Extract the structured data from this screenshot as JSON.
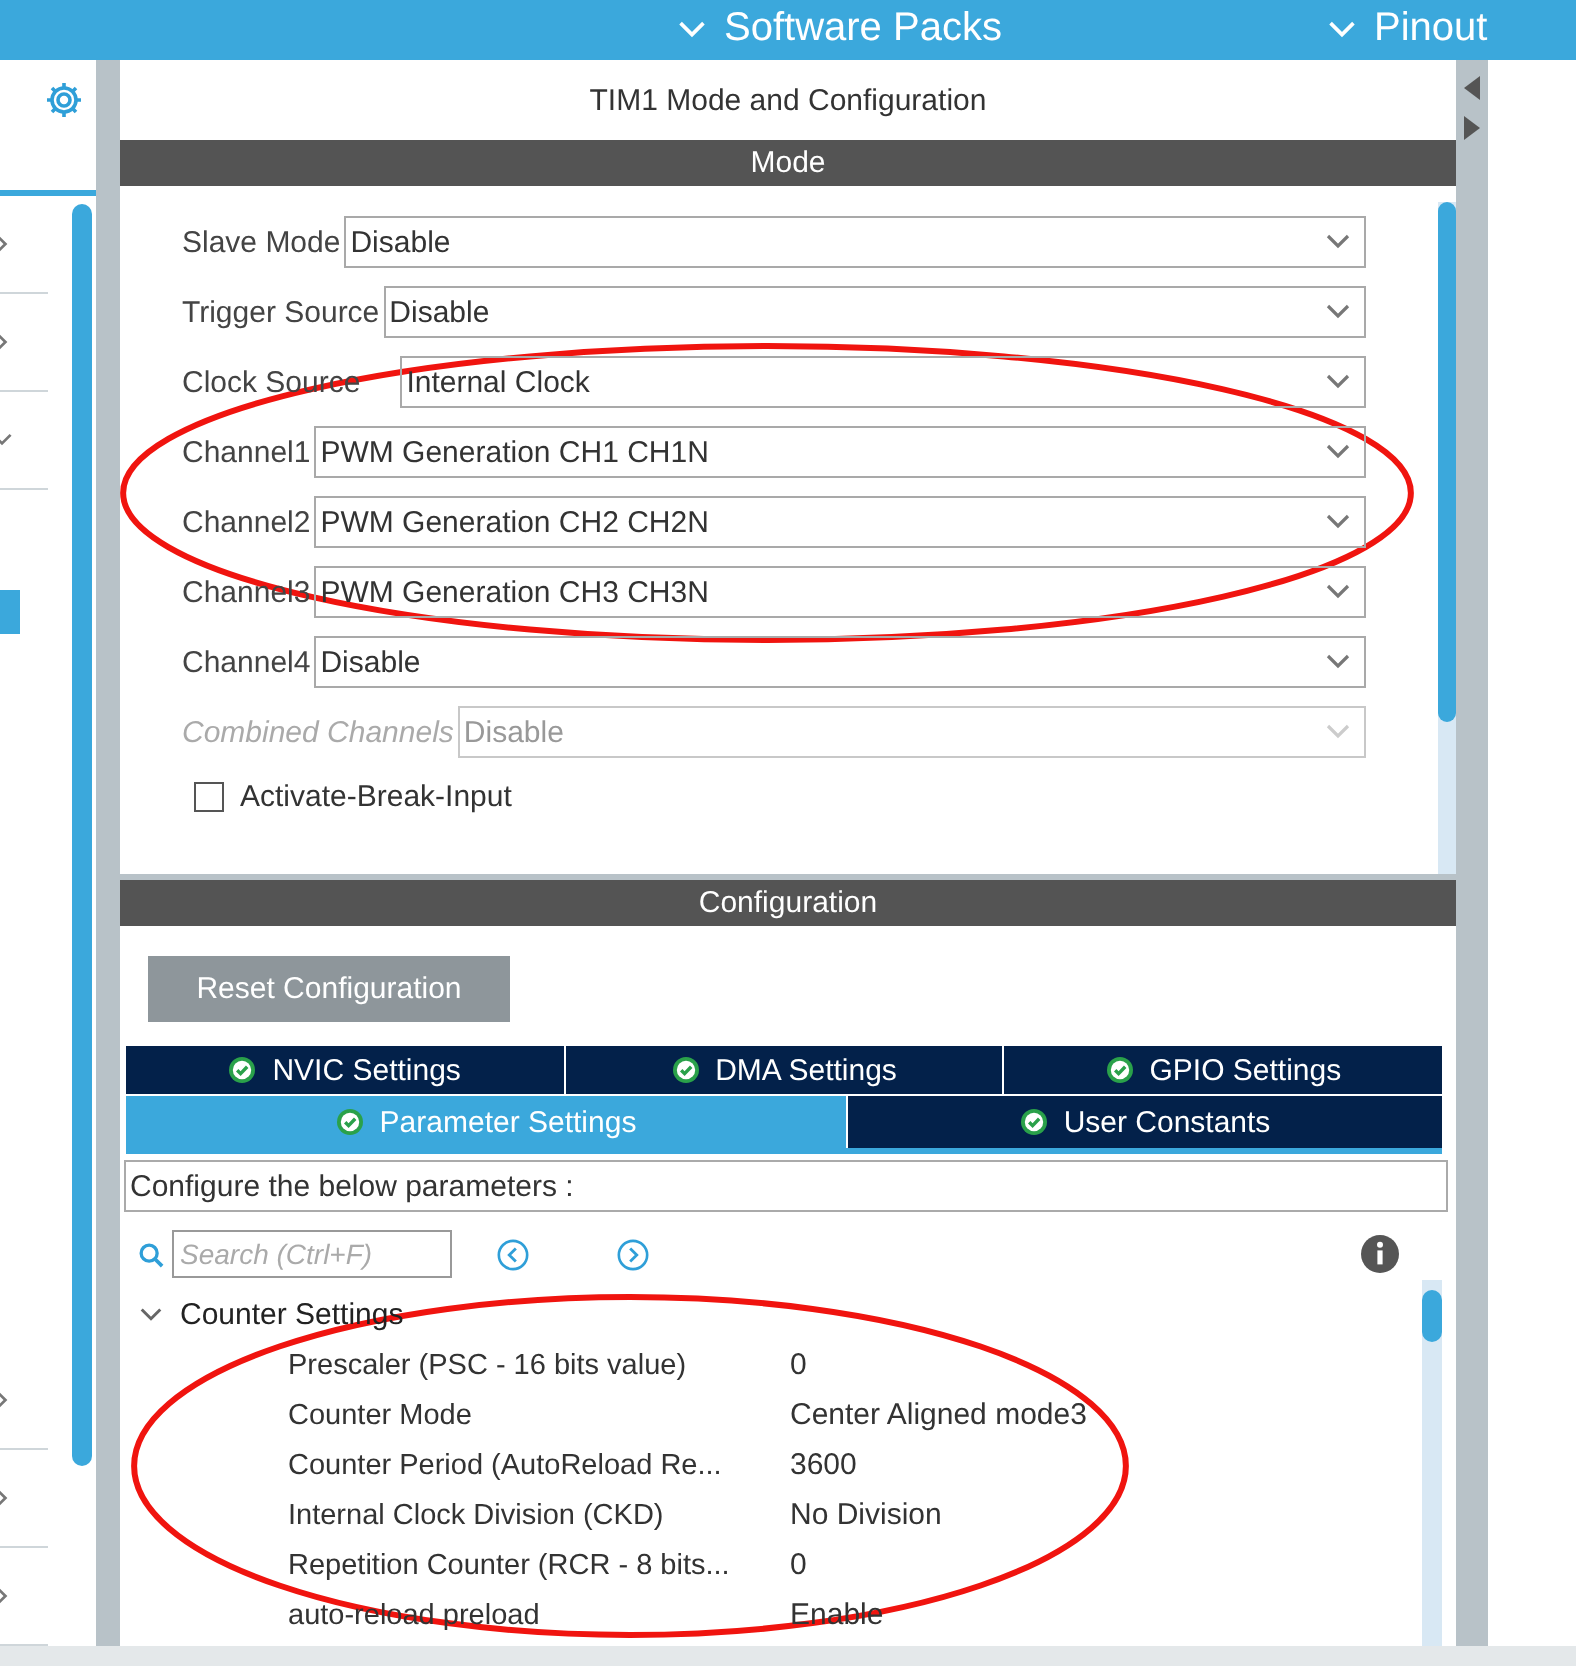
{
  "top_bar": {
    "menus": [
      {
        "label": "Software Packs"
      },
      {
        "label": "Pinout"
      }
    ]
  },
  "sidebar": {
    "top_items": [
      {
        "kind": "category",
        "expanded": false
      },
      {
        "kind": "category",
        "expanded": false
      },
      {
        "kind": "category",
        "expanded": true
      },
      {
        "kind": "entry",
        "selected": true
      }
    ],
    "bottom_items": [
      {
        "kind": "category",
        "expanded": false
      },
      {
        "kind": "category",
        "expanded": false
      },
      {
        "kind": "category",
        "expanded": false
      }
    ]
  },
  "panel": {
    "title": "TIM1 Mode and Configuration",
    "mode": {
      "header": "Mode",
      "fields": [
        {
          "label": "Slave Mode",
          "value": "Disable",
          "disabled": false
        },
        {
          "label": "Trigger Source",
          "value": "Disable",
          "disabled": false
        },
        {
          "label": "Clock Source",
          "value": "Internal Clock",
          "disabled": false
        },
        {
          "label": "Channel1",
          "value": "PWM Generation CH1 CH1N",
          "disabled": false
        },
        {
          "label": "Channel2",
          "value": "PWM Generation CH2 CH2N",
          "disabled": false
        },
        {
          "label": "Channel3",
          "value": "PWM Generation CH3 CH3N",
          "disabled": false
        },
        {
          "label": "Channel4",
          "value": "Disable",
          "disabled": false
        },
        {
          "label": "Combined Channels",
          "value": "Disable",
          "disabled": true
        }
      ],
      "checkboxes": [
        {
          "label": "Activate-Break-Input",
          "checked": false
        }
      ],
      "annotations": [
        {
          "kind": "ellipse"
        }
      ]
    },
    "configuration": {
      "header": "Configuration",
      "reset_button": "Reset Configuration",
      "tab_rows": [
        [
          {
            "label": "NVIC Settings",
            "selected": false
          },
          {
            "label": "DMA Settings",
            "selected": false
          },
          {
            "label": "GPIO Settings",
            "selected": false
          }
        ],
        [
          {
            "label": "Parameter Settings",
            "selected": true
          },
          {
            "label": "User Constants",
            "selected": false
          }
        ]
      ],
      "description": "Configure the below parameters :",
      "search": {
        "placeholder": "Search (Ctrl+F)"
      },
      "groups": [
        {
          "label": "Counter Settings",
          "expanded": true,
          "children": [
            {
              "name": "Prescaler (PSC - 16 bits value)",
              "value": "0"
            },
            {
              "name": "Counter Mode",
              "value": "Center Aligned mode3"
            },
            {
              "name": "Counter Period (AutoReload Re...",
              "value": "3600"
            },
            {
              "name": "Internal Clock Division (CKD)",
              "value": "No Division"
            },
            {
              "name": "Repetition Counter (RCR - 8 bits...",
              "value": "0"
            },
            {
              "name": "auto-reload preload",
              "value": "Enable"
            }
          ]
        }
      ],
      "annotations": [
        {
          "kind": "ellipse"
        }
      ]
    }
  }
}
